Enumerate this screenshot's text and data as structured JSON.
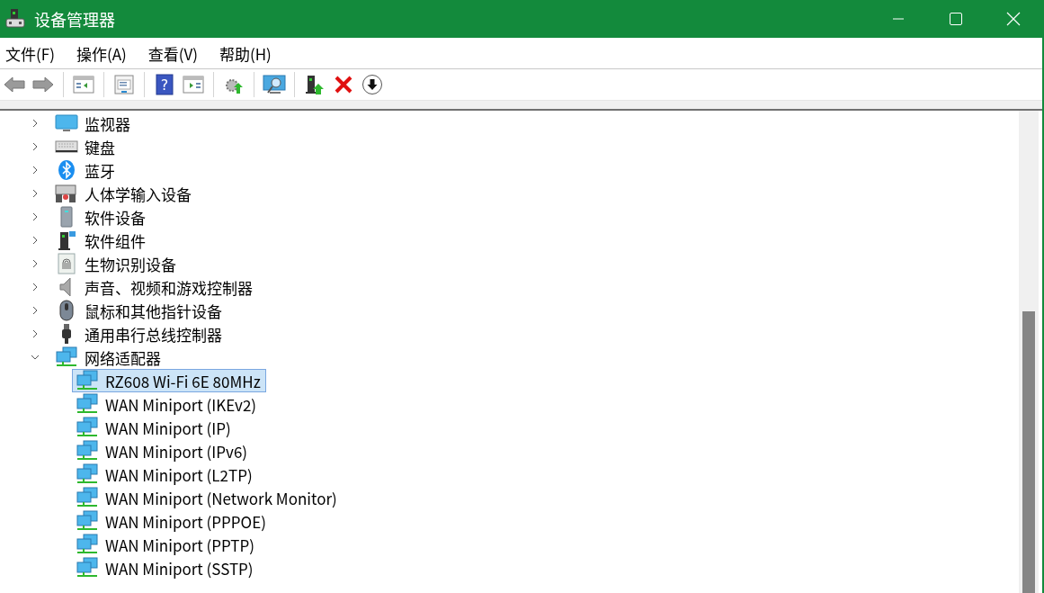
{
  "window": {
    "title": "设备管理器"
  },
  "menu": [
    {
      "label": "文件(F)"
    },
    {
      "label": "操作(A)"
    },
    {
      "label": "查看(V)"
    },
    {
      "label": "帮助(H)"
    }
  ],
  "toolbar": [
    {
      "kind": "back"
    },
    {
      "kind": "forward"
    },
    {
      "kind": "sep"
    },
    {
      "kind": "tree"
    },
    {
      "kind": "sep"
    },
    {
      "kind": "properties"
    },
    {
      "kind": "sep"
    },
    {
      "kind": "help",
      "glyph": "?"
    },
    {
      "kind": "pane"
    },
    {
      "kind": "sep"
    },
    {
      "kind": "scan"
    },
    {
      "kind": "sep"
    },
    {
      "kind": "monitor-search"
    },
    {
      "kind": "sep"
    },
    {
      "kind": "update"
    },
    {
      "kind": "remove"
    },
    {
      "kind": "disable"
    }
  ],
  "tree": [
    {
      "label": "监视器",
      "kind": "monitor",
      "expanded": false
    },
    {
      "label": "键盘",
      "kind": "keyboard",
      "expanded": false
    },
    {
      "label": "蓝牙",
      "kind": "bluetooth",
      "expanded": false
    },
    {
      "label": "人体学输入设备",
      "kind": "hid",
      "expanded": false
    },
    {
      "label": "软件设备",
      "kind": "software",
      "expanded": false
    },
    {
      "label": "软件组件",
      "kind": "component",
      "expanded": false
    },
    {
      "label": "生物识别设备",
      "kind": "biometric",
      "expanded": false
    },
    {
      "label": "声音、视频和游戏控制器",
      "kind": "sound",
      "expanded": false
    },
    {
      "label": "鼠标和其他指针设备",
      "kind": "mouse",
      "expanded": false
    },
    {
      "label": "通用串行总线控制器",
      "kind": "usb",
      "expanded": false
    },
    {
      "label": "网络适配器",
      "kind": "network",
      "expanded": true,
      "children": [
        {
          "label": "RZ608 Wi-Fi 6E 80MHz",
          "kind": "network",
          "selected": true
        },
        {
          "label": "WAN Miniport (IKEv2)",
          "kind": "network",
          "selected": false
        },
        {
          "label": "WAN Miniport (IP)",
          "kind": "network",
          "selected": false
        },
        {
          "label": "WAN Miniport (IPv6)",
          "kind": "network",
          "selected": false
        },
        {
          "label": "WAN Miniport (L2TP)",
          "kind": "network",
          "selected": false
        },
        {
          "label": "WAN Miniport (Network Monitor)",
          "kind": "network",
          "selected": false
        },
        {
          "label": "WAN Miniport (PPPOE)",
          "kind": "network",
          "selected": false
        },
        {
          "label": "WAN Miniport (PPTP)",
          "kind": "network",
          "selected": false
        },
        {
          "label": "WAN Miniport (SSTP)",
          "kind": "network",
          "selected": false
        }
      ]
    }
  ]
}
